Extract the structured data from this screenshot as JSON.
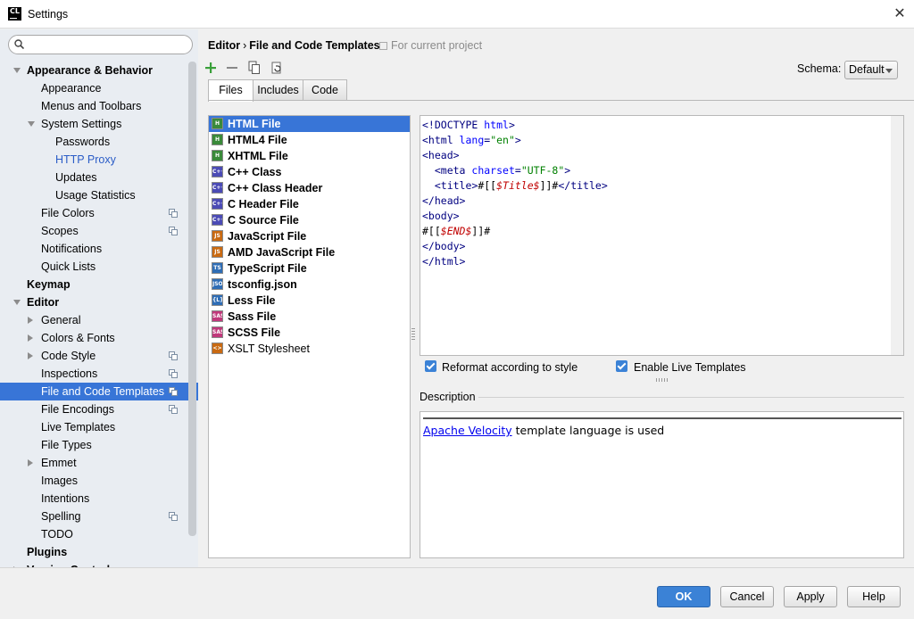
{
  "window": {
    "title": "Settings",
    "app_icon": "CL"
  },
  "search": {
    "placeholder": ""
  },
  "tree": [
    {
      "label": "Appearance & Behavior",
      "level": 0,
      "bold": true,
      "expanded": true
    },
    {
      "label": "Appearance",
      "level": 1
    },
    {
      "label": "Menus and Toolbars",
      "level": 1
    },
    {
      "label": "System Settings",
      "level": 1,
      "expanded": true
    },
    {
      "label": "Passwords",
      "level": 2
    },
    {
      "label": "HTTP Proxy",
      "level": 2,
      "link": true
    },
    {
      "label": "Updates",
      "level": 2
    },
    {
      "label": "Usage Statistics",
      "level": 2
    },
    {
      "label": "File Colors",
      "level": 1,
      "project": true
    },
    {
      "label": "Scopes",
      "level": 1,
      "project": true
    },
    {
      "label": "Notifications",
      "level": 1
    },
    {
      "label": "Quick Lists",
      "level": 1
    },
    {
      "label": "Keymap",
      "level": 0,
      "bold": true
    },
    {
      "label": "Editor",
      "level": 0,
      "bold": true,
      "expanded": true
    },
    {
      "label": "General",
      "level": 1,
      "collapsed": true
    },
    {
      "label": "Colors & Fonts",
      "level": 1,
      "collapsed": true
    },
    {
      "label": "Code Style",
      "level": 1,
      "collapsed": true,
      "project": true
    },
    {
      "label": "Inspections",
      "level": 1,
      "project": true
    },
    {
      "label": "File and Code Templates",
      "level": 1,
      "project": true,
      "selected": true
    },
    {
      "label": "File Encodings",
      "level": 1,
      "project": true
    },
    {
      "label": "Live Templates",
      "level": 1
    },
    {
      "label": "File Types",
      "level": 1
    },
    {
      "label": "Emmet",
      "level": 1,
      "collapsed": true
    },
    {
      "label": "Images",
      "level": 1
    },
    {
      "label": "Intentions",
      "level": 1
    },
    {
      "label": "Spelling",
      "level": 1,
      "project": true
    },
    {
      "label": "TODO",
      "level": 1
    },
    {
      "label": "Plugins",
      "level": 0,
      "bold": true
    },
    {
      "label": "Version Control",
      "level": 0,
      "bold": true,
      "collapsed": true
    }
  ],
  "breadcrumb": {
    "parent": "Editor",
    "separator": "›",
    "current": "File and Code Templates",
    "scope": "For current project"
  },
  "schema": {
    "label": "Schema:",
    "value": "Default"
  },
  "tabs": [
    "Files",
    "Includes",
    "Code"
  ],
  "templates": [
    {
      "name": "HTML File",
      "icon": "html-file-icon",
      "color": "#3a8a3a",
      "glyph": "H",
      "selected": true
    },
    {
      "name": "HTML4 File",
      "icon": "html-file-icon",
      "color": "#3a8a3a",
      "glyph": "H"
    },
    {
      "name": "XHTML File",
      "icon": "html-file-icon",
      "color": "#3a8a3a",
      "glyph": "H"
    },
    {
      "name": "C++ Class",
      "icon": "cpp-file-icon",
      "color": "#4b4bb5",
      "glyph": "C++"
    },
    {
      "name": "C++ Class Header",
      "icon": "cpp-file-icon",
      "color": "#4b4bb5",
      "glyph": "C++"
    },
    {
      "name": "C Header File",
      "icon": "c-file-icon",
      "color": "#4b4bb5",
      "glyph": "C++"
    },
    {
      "name": "C Source File",
      "icon": "c-file-icon",
      "color": "#4b4bb5",
      "glyph": "C++"
    },
    {
      "name": "JavaScript File",
      "icon": "js-file-icon",
      "color": "#c96a12",
      "glyph": "JS"
    },
    {
      "name": "AMD JavaScript File",
      "icon": "js-file-icon",
      "color": "#c96a12",
      "glyph": "JS"
    },
    {
      "name": "TypeScript File",
      "icon": "ts-file-icon",
      "color": "#2f6db5",
      "glyph": "TS"
    },
    {
      "name": "tsconfig.json",
      "icon": "json-file-icon",
      "color": "#2f6db5",
      "glyph": "JSON"
    },
    {
      "name": "Less File",
      "icon": "less-file-icon",
      "color": "#2f6db5",
      "glyph": "{L}"
    },
    {
      "name": "Sass File",
      "icon": "sass-file-icon",
      "color": "#c0397b",
      "glyph": "SASS"
    },
    {
      "name": "SCSS File",
      "icon": "scss-file-icon",
      "color": "#c0397b",
      "glyph": "SASS"
    },
    {
      "name": "XSLT Stylesheet",
      "icon": "xslt-file-icon",
      "color": "#c96a12",
      "glyph": "<>",
      "normal": true
    }
  ],
  "code": [
    [
      [
        "t",
        "<!DOCTYPE "
      ],
      [
        "a",
        "html"
      ],
      [
        "t",
        ">"
      ]
    ],
    [
      [
        "t",
        "<html "
      ],
      [
        "a",
        "lang"
      ],
      [
        "t",
        "="
      ],
      [
        "s",
        "\"en\""
      ],
      [
        "t",
        ">"
      ]
    ],
    [
      [
        "t",
        "<head>"
      ]
    ],
    [
      [
        "p",
        "  "
      ],
      [
        "t",
        "<meta "
      ],
      [
        "a",
        "charset"
      ],
      [
        "t",
        "="
      ],
      [
        "s",
        "\"UTF-8\""
      ],
      [
        "t",
        ">"
      ]
    ],
    [
      [
        "p",
        "  "
      ],
      [
        "t",
        "<title>"
      ],
      [
        "p",
        "#[["
      ],
      [
        "v",
        "$Title$"
      ],
      [
        "p",
        "]]#"
      ],
      [
        "t",
        "</title>"
      ]
    ],
    [
      [
        "t",
        "</head>"
      ]
    ],
    [
      [
        "t",
        "<body>"
      ]
    ],
    [
      [
        "p",
        "#[["
      ],
      [
        "v",
        "$END$"
      ],
      [
        "p",
        "]]#"
      ]
    ],
    [
      [
        "t",
        "</body>"
      ]
    ],
    [
      [
        "t",
        "</html>"
      ]
    ]
  ],
  "options": {
    "reformat": "Reformat according to style",
    "live_templates": "Enable Live Templates",
    "reformat_checked": true,
    "live_checked": true
  },
  "description": {
    "label": "Description",
    "link": "Apache Velocity",
    "text": " template language is used"
  },
  "buttons": {
    "ok": "OK",
    "cancel": "Cancel",
    "apply": "Apply",
    "help": "Help"
  }
}
